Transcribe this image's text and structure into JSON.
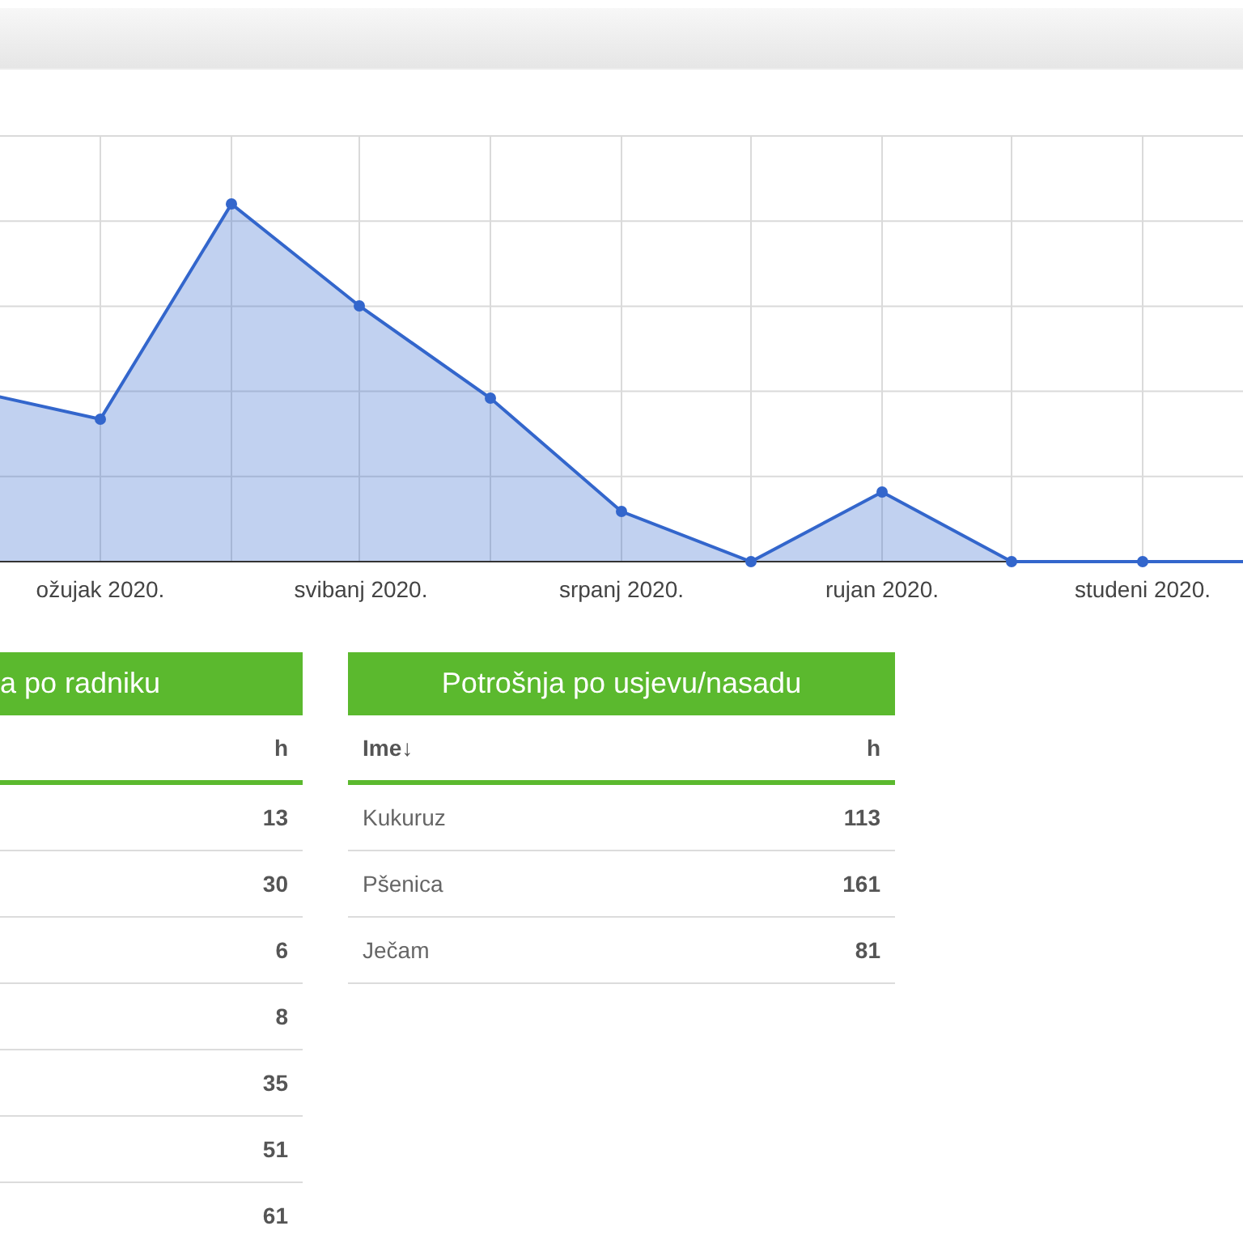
{
  "chart": {
    "kind": "picture",
    "x_labels": [
      "ožujak 2020.",
      "svibanj 2020.",
      "srpanj 2020.",
      "rujan 2020.",
      "studeni 2020."
    ]
  },
  "tables": [
    {
      "title": "a po radniku",
      "columns": [
        "h"
      ],
      "rows": [
        [
          "13"
        ],
        [
          "30"
        ],
        [
          "6"
        ],
        [
          "8"
        ],
        [
          "35"
        ],
        [
          "51"
        ],
        [
          "61"
        ]
      ]
    },
    {
      "title": "Potrošnja po usjevu/nasadu",
      "columns": [
        "Ime↓",
        "h"
      ],
      "rows": [
        [
          "Kukuruz",
          "113"
        ],
        [
          "Pšenica",
          "161"
        ],
        [
          "Ječam",
          "81"
        ]
      ]
    }
  ]
}
